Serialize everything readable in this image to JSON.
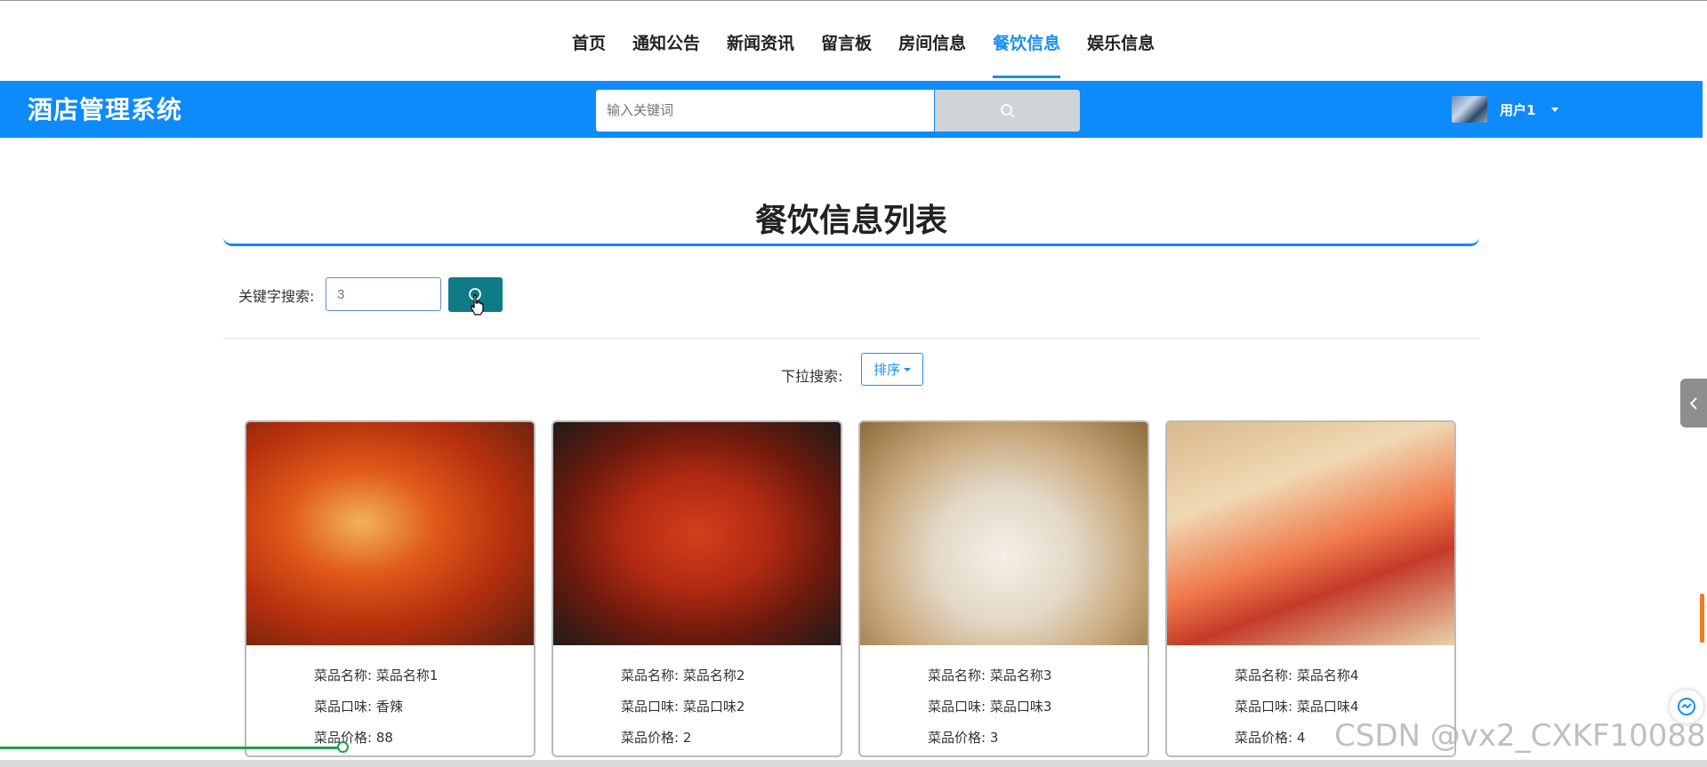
{
  "nav": {
    "items": [
      {
        "label": "首页"
      },
      {
        "label": "通知公告"
      },
      {
        "label": "新闻资讯"
      },
      {
        "label": "留言板"
      },
      {
        "label": "房间信息"
      },
      {
        "label": "餐饮信息",
        "active": true
      },
      {
        "label": "娱乐信息"
      }
    ]
  },
  "header": {
    "brand": "酒店管理系统",
    "search_placeholder": "输入关键词",
    "user_name": "用户1"
  },
  "page": {
    "title": "餐饮信息列表",
    "keyword_label": "关键字搜索:",
    "keyword_value": "3",
    "dropdown_label": "下拉搜索:",
    "sort_label": "排序"
  },
  "cards": [
    {
      "name": "菜品名称: 菜品名称1",
      "taste": "菜品口味: 香辣",
      "price": "菜品价格: 88"
    },
    {
      "name": "菜品名称: 菜品名称2",
      "taste": "菜品口味: 菜品口味2",
      "price": "菜品价格: 2"
    },
    {
      "name": "菜品名称: 菜品名称3",
      "taste": "菜品口味: 菜品口味3",
      "price": "菜品价格: 3"
    },
    {
      "name": "菜品名称: 菜品名称4",
      "taste": "菜品口味: 菜品口味4",
      "price": "菜品价格: 4"
    }
  ],
  "watermark": "CSDN @vx2_CXKF10088",
  "colors": {
    "accent": "#0d8bfa",
    "search_button": "#0f7b86"
  }
}
